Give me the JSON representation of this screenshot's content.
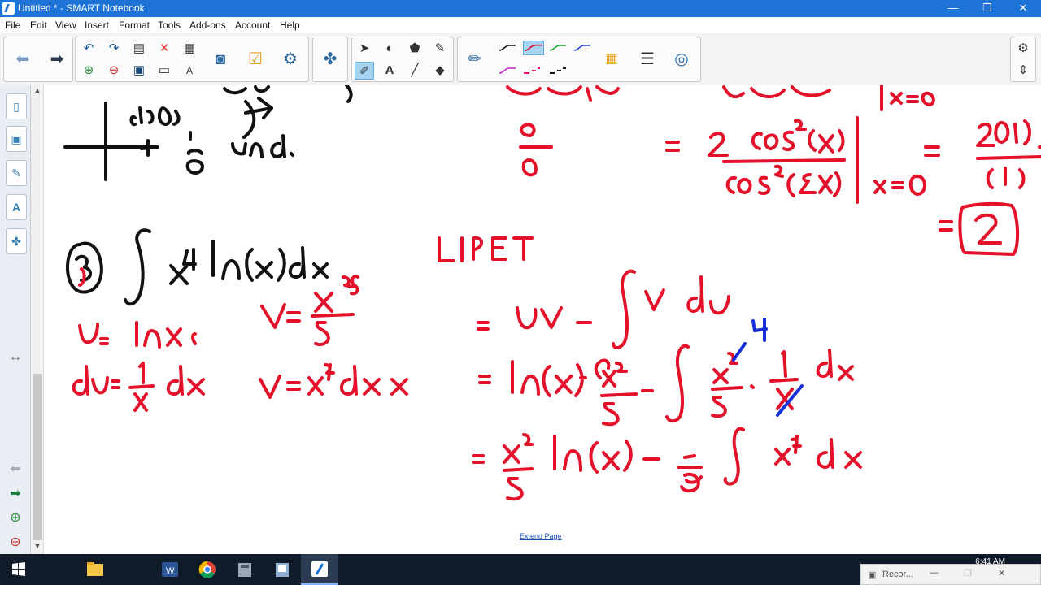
{
  "window": {
    "title": "Untitled * - SMART Notebook",
    "minimize": "—",
    "restore": "❐",
    "close": "✕"
  },
  "menu": [
    "File",
    "Edit",
    "View",
    "Insert",
    "Format",
    "Tools",
    "Add-ons",
    "Account",
    "Help"
  ],
  "toolbar": {
    "icons": [
      "back-arrow-icon",
      "forward-arrow-icon",
      "undo-icon",
      "redo-icon",
      "screen-shade-icon",
      "delete-icon",
      "table-icon",
      "add-page-icon",
      "delete-page-icon",
      "save-icon",
      "full-screen-icon",
      "text-recognition-icon",
      "document-camera-icon",
      "response-icon",
      "activity-builder-icon",
      "add-ons-icon",
      "select-icon",
      "shapes-icon",
      "fill-icon",
      "magic-pen-icon",
      "pens-icon",
      "text-icon",
      "lines-icon",
      "eraser-icon",
      "pen-icon",
      "color-palette-icon",
      "line-style-icon",
      "fill-effects-icon",
      "settings-icon",
      "move-toolbar-icon"
    ],
    "pen_colors": [
      "#111111",
      "#e0103a",
      "#1aa52a",
      "#2a3fd0",
      "#c81ecf",
      "#e01070",
      "#111111"
    ]
  },
  "canvas": {
    "extend_page": "Extend Page"
  },
  "taskbar": {
    "clock": "6:41 AM",
    "recorder_label": "Recor..."
  }
}
